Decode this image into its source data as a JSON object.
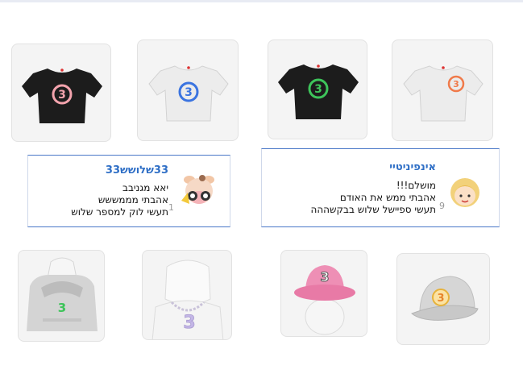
{
  "items_row1": [
    {
      "name": "black tee pink 3",
      "icon": "black-tshirt-pink-3-icon"
    },
    {
      "name": "white tee blue 3",
      "icon": "white-tshirt-blue-3-icon"
    },
    {
      "name": "black tee green 3",
      "icon": "black-tshirt-green-3-icon"
    },
    {
      "name": "white tee orange 3",
      "icon": "white-tshirt-orange-3-icon"
    }
  ],
  "comments": [
    {
      "username": "33שלושש33",
      "lines": [
        "יאא מגניבב",
        "אהבתי מממששש",
        "תעשי לוק למספר שלוש"
      ],
      "number": "1",
      "avatar": "cow-avatar-icon"
    },
    {
      "username": "אינפיניטיי",
      "lines": [
        "מושלם!!!",
        "אהבתי ממש את האודם",
        "תעשי ספיישל שלוש בבקשההה"
      ],
      "number": "9",
      "avatar": "blonde-avatar-icon"
    }
  ],
  "items_row2": [
    {
      "name": "grey hoodie green 3",
      "icon": "grey-hoodie-green-3-icon"
    },
    {
      "name": "chain necklace 3",
      "icon": "necklace-3-icon"
    },
    {
      "name": "pink bucket hat 3",
      "icon": "pink-bucket-hat-3-icon"
    },
    {
      "name": "grey cap orange 3",
      "icon": "grey-cap-orange-3-icon"
    }
  ],
  "colors": {
    "username": "#2f6fc6",
    "card_bg": "#f4f4f4",
    "comment_border": "#4a78c8",
    "black_shirt": "#1c1c1c",
    "white_shirt": "#ececec",
    "pink_3": "#f3a3ad",
    "blue_3": "#3b74e0",
    "green_3": "#3dc45a",
    "orange_3": "#f07a4a",
    "hat_pink": "#ee8fb5"
  }
}
